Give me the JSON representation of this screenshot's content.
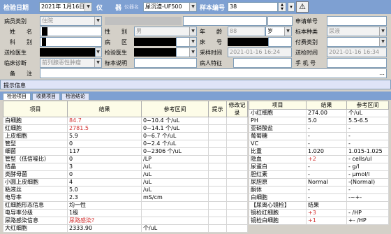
{
  "header": {
    "test_date_label": "检验日期",
    "test_date": "2021年 1月16日",
    "instrument_label": "仪　　器",
    "instrument_name": "仪器名",
    "instrument": "尿沉渣-UF500",
    "sample_label": "样本编号",
    "sample_no": "38"
  },
  "form": {
    "patient_type_label": "病员类别",
    "patient_type": "住院",
    "name_label": "姓　　名",
    "gender_label": "性　　别",
    "gender": "男",
    "age_label": "年　　龄",
    "age": "88",
    "age_unit": "岁",
    "department_label": "科　　别",
    "ward_label": "病　　区",
    "bed_label": "床　　号",
    "doctor_label": "送检医生",
    "test_doctor_label": "检验医生",
    "sample_time_label": "采样时间",
    "sample_time": "2021-01-16 16:24",
    "send_time_label": "送检时间",
    "send_time": "2021-01-16 16:34",
    "request_no_label": "申请单号",
    "sample_type_label": "标本种类",
    "sample_type": "尿液",
    "payment_label": "付费类别",
    "diagnosis_label": "临床诊断",
    "diagnosis": "前列腺恶性肿瘤",
    "sample_note_label": "标本说明",
    "patient_feature_label": "病人特征",
    "phone_label": "手 机 号",
    "remark_label": "备　　注",
    "prompt_label": "提示信息"
  },
  "tabs": [
    "检验项目",
    "收费项目",
    "检验结论"
  ],
  "left_table": {
    "headers": [
      "项目",
      "结果",
      "参考区间",
      "提示",
      "修改记录"
    ],
    "rows": [
      {
        "item": "白细胞",
        "result": "84.7",
        "ref": "0~10.4 个/uL"
      },
      {
        "item": "红细胞",
        "result": "2781.5",
        "ref": "0~14.1 个/uL"
      },
      {
        "item": "上皮细胞",
        "result": "5.9",
        "ref": "0~6.7 个/uL"
      },
      {
        "item": "管型",
        "result": "0",
        "ref": "0~2.4 个/uL"
      },
      {
        "item": "细菌",
        "result": "117",
        "ref": "0~2306 个/uL"
      },
      {
        "item": "管型（低信噪比）",
        "result": "0",
        "ref": "/LP"
      },
      {
        "item": "结晶",
        "result": "3",
        "ref": "/uL"
      },
      {
        "item": "类酵母菌",
        "result": "0",
        "ref": "/uL"
      },
      {
        "item": "小圆上皮细胞",
        "result": "4",
        "ref": "/uL"
      },
      {
        "item": "粘液丝",
        "result": "5.0",
        "ref": "/uL"
      },
      {
        "item": "电导率",
        "result": "2.3",
        "ref": "mS/cm"
      },
      {
        "item": "红细胞形态信息",
        "result": "均一性",
        "ref": ""
      },
      {
        "item": "电导率分级",
        "result": "1级",
        "ref": ""
      },
      {
        "item": "尿路感染信息",
        "result": "尿路感染?",
        "ref": ""
      },
      {
        "item": "大红细胞",
        "result": "2333.90",
        "ref": "个/uL"
      }
    ]
  },
  "right_table": {
    "headers": [
      "项目",
      "结果",
      "参考区间"
    ],
    "rows": [
      {
        "item": "小红细胞",
        "result": "274.00",
        "ref": "个/uL"
      },
      {
        "item": "PH",
        "result": "5.0",
        "ref": "5.5-6.5"
      },
      {
        "item": "亚硝酸盐",
        "result": "-",
        "ref": "-"
      },
      {
        "item": "葡萄糖",
        "result": "-",
        "ref": "-"
      },
      {
        "item": "VC",
        "result": "-",
        "ref": "-"
      },
      {
        "item": "比重",
        "result": "1.020",
        "ref": "1.015-1.025"
      },
      {
        "item": "隐血",
        "result": "+2",
        "ref": "- cells/ul"
      },
      {
        "item": "尿蛋白",
        "result": "-",
        "ref": "- g/l"
      },
      {
        "item": "胆红素",
        "result": "-",
        "ref": "- μmol/l"
      },
      {
        "item": "尿胆原",
        "result": "Normal",
        "ref": "-(Normal)"
      },
      {
        "item": "酮体",
        "result": "-",
        "ref": "-"
      },
      {
        "item": "白细胞",
        "result": "-",
        "ref": "-~+-"
      },
      {
        "item": "【尿离心镜检】",
        "result": "结果",
        "ref": ""
      },
      {
        "item": "镜检红细胞",
        "result": "+3",
        "ref": "- /HP"
      },
      {
        "item": "镜检白细胞",
        "result": "+1",
        "ref": "+- /HP"
      }
    ]
  }
}
